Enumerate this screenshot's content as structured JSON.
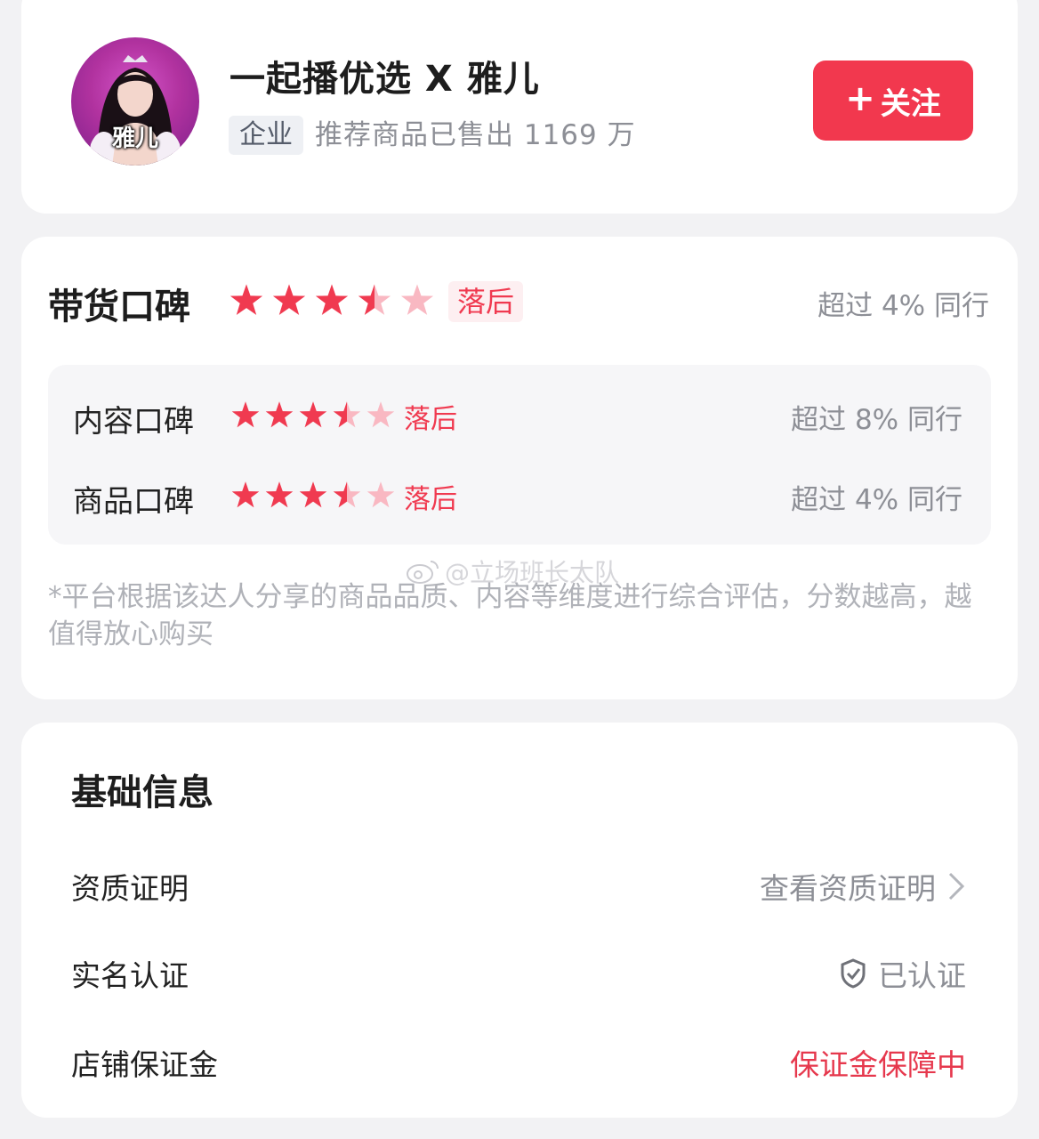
{
  "profile": {
    "avatar_label": "雅儿",
    "name": "一起播优选 X 雅儿",
    "badge": "企业",
    "sold_text": "推荐商品已售出 1169 万",
    "follow_label": "关注",
    "follow_icon": "plus-icon"
  },
  "rating": {
    "title": "带货口碑",
    "overall": {
      "stars": 3.5,
      "level": "落后",
      "beat": "超过 4% 同行"
    },
    "sub": [
      {
        "label": "内容口碑",
        "stars": 3.5,
        "level": "落后",
        "beat": "超过 8% 同行"
      },
      {
        "label": "商品口碑",
        "stars": 3.5,
        "level": "落后",
        "beat": "超过 4% 同行"
      }
    ],
    "note": "*平台根据该达人分享的商品品质、内容等维度进行综合评估，分数越高，越值得放心购买"
  },
  "info": {
    "title": "基础信息",
    "rows": [
      {
        "label": "资质证明",
        "value": "查看资质证明",
        "icon": "chevron-right-icon"
      },
      {
        "label": "实名认证",
        "value": "已认证",
        "icon": "shield-check-icon"
      },
      {
        "label": "店铺保证金",
        "value": "保证金保障中"
      }
    ]
  },
  "watermark": "@立场班长太队",
  "colors": {
    "accent": "#f2384e",
    "star_filled": "#f03a50",
    "star_empty": "#f9b8c2",
    "page_bg": "#f2f2f4"
  }
}
